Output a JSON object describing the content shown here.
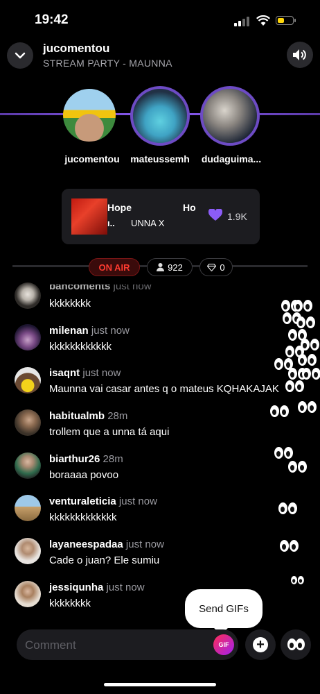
{
  "status": {
    "time": "19:42"
  },
  "header": {
    "title": "jucomentou",
    "subtitle": "STREAM PARTY - MAUNNA"
  },
  "participants": [
    {
      "name": "jucomentou"
    },
    {
      "name": "mateussemh"
    },
    {
      "name": "dudaguima..."
    }
  ],
  "now_playing": {
    "title": "Hope",
    "title_continued": "Ho",
    "artist": "UNNA X",
    "artist_prefix": "ı..",
    "likes": "1.9K"
  },
  "live": {
    "status": "ON AIR",
    "viewers": "922",
    "gems": "0"
  },
  "chat": [
    {
      "user": "bancoments",
      "time": "just now",
      "text": "kkkkkkkk"
    },
    {
      "user": "milenan",
      "time": "just now",
      "text": "kkkkkkkkkkkk"
    },
    {
      "user": "isaqnt",
      "time": "just now",
      "text": "Maunna vai casar antes q o mateus KQHAKAJAK"
    },
    {
      "user": "habitualmb",
      "time": "28m",
      "text": "trollem que a unna tá aqui"
    },
    {
      "user": "biarthur26",
      "time": "28m",
      "text": "boraaaa povoo"
    },
    {
      "user": "venturaleticia",
      "time": "just now",
      "text": "kkkkkkkkkkkkk"
    },
    {
      "user": "layaneespadaa",
      "time": "just now",
      "text": "Cade o juan? Ele sumiu"
    },
    {
      "user": "jessiqunha",
      "time": "just now",
      "text": "kkkkkkkk"
    }
  ],
  "composer": {
    "placeholder": "Comment",
    "gif_label": "GIF",
    "tooltip": "Send GIFs"
  },
  "colors": {
    "accent": "#6d4bc4",
    "live": "#ff3b30",
    "heart": "#8b5cf6"
  }
}
